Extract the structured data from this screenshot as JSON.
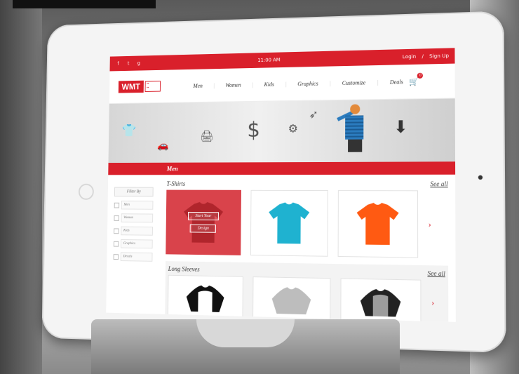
{
  "status": {
    "time": "11:00 AM",
    "login": "Login",
    "signup": "Sign Up",
    "social": [
      "f",
      "t",
      "g"
    ]
  },
  "logo": {
    "main": "WMT"
  },
  "nav": [
    "Men",
    "Women",
    "Kids",
    "Graphics",
    "Customize",
    "Deals"
  ],
  "cart": {
    "count": "0"
  },
  "category": "Men",
  "sidebar": {
    "title": "Filter By",
    "items": [
      "Men",
      "Women",
      "Kids",
      "Graphics",
      "Decals"
    ]
  },
  "sections": [
    {
      "title": "T-Shirts",
      "see_all": "See all",
      "card_buttons": [
        "Start Your",
        "Design"
      ]
    },
    {
      "title": "Long Sleeves",
      "see_all": "See all"
    }
  ],
  "colors": {
    "brand_red": "#d9202b",
    "shirt_blue": "#1fb2d0",
    "shirt_orange": "#ff5a12"
  }
}
